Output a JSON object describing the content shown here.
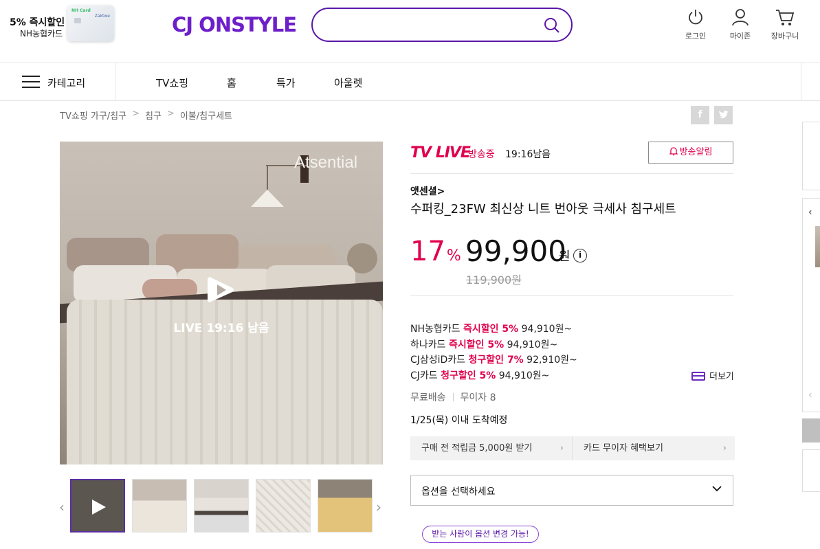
{
  "promo": {
    "line1": "5% 즉시할인",
    "line2": "NH농협카드",
    "card_brand": "NH Card",
    "card_sub": "Zaktwe"
  },
  "logo": "CJ ONSTYLE",
  "search": {
    "placeholder": "",
    "value": ""
  },
  "topnav": {
    "login": "로그인",
    "mypage": "마이존",
    "cart": "장바구니"
  },
  "nav": {
    "category": "카테고리",
    "items": [
      "TV쇼핑",
      "홈",
      "특가",
      "아울렛"
    ]
  },
  "breadcrumb": [
    "TV쇼핑 가구/침구",
    "침구",
    "이불/침구세트"
  ],
  "sns": {
    "facebook": "f",
    "twitter": "t"
  },
  "hero": {
    "brand_overlay": "Atsential",
    "live_text": "LIVE  19:16 남음"
  },
  "thumbs": [
    "thumb-1",
    "thumb-2",
    "thumb-3",
    "thumb-4",
    "thumb-5"
  ],
  "live": {
    "badge": "TV LIVE",
    "status": "방송중",
    "remaining": "19:16남음",
    "alarm_label": "방송알림"
  },
  "product": {
    "brand": "앳센셜",
    "title": "수퍼킹_23FW 최신상 니트 번아웃 극세사 침구세트",
    "discount_rate": "17",
    "discount_unit": "%",
    "price": "99,900",
    "won": "원",
    "info_icon": "i",
    "original_price": "119,900원"
  },
  "card_offers": [
    {
      "card": "NH농협카드 ",
      "hl": "즉시할인 5%",
      "price": " 94,910원~"
    },
    {
      "card": "하나카드 ",
      "hl": "즉시할인 5%",
      "price": " 94,910원~"
    },
    {
      "card": "CJ삼성iD카드 ",
      "hl": "청구할인 7%",
      "price": " 92,910원~"
    },
    {
      "card": "CJ카드 ",
      "hl": "청구할인 5%",
      "price": " 94,910원~"
    }
  ],
  "more_label": "더보기",
  "shipping": {
    "free": "무료배송",
    "installment": "무이자 8"
  },
  "arrival": "1/25(목) 이내 도착예정",
  "benefits": {
    "points": "구매 전 적립금 5,000원 받기",
    "card": "카드 무이자 혜택보기"
  },
  "option": {
    "placeholder": "옵션을 선택하세요"
  },
  "tip": "받는 사람이 옵션 변경 가능!",
  "colors": {
    "brand": "#6d1fc9",
    "accent": "#e0004d"
  }
}
